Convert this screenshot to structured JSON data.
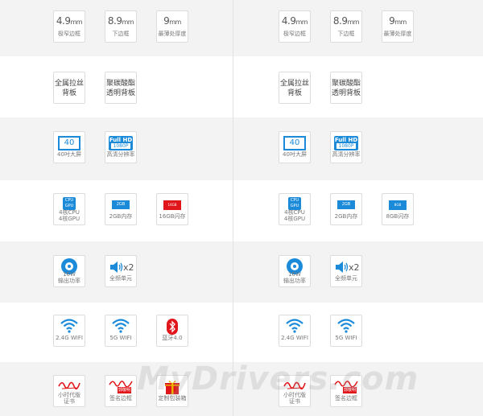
{
  "left": {
    "row1": [
      {
        "main": "4.9",
        "unit": "mm",
        "sub": "极窄边框"
      },
      {
        "main": "8.9",
        "unit": "mm",
        "sub": "下边框"
      },
      {
        "main": "9",
        "unit": "mm",
        "sub": "最薄处厚度"
      }
    ],
    "row2": [
      {
        "line1": "全属拉丝",
        "line2": "背板"
      },
      {
        "line1": "聚碳酸酯",
        "line2": "透明背板"
      }
    ],
    "row3": [
      {
        "icon": "40",
        "sub": "40吋大屏"
      },
      {
        "icon1": "Full HD",
        "icon2": "1080P",
        "sub": "高清分辨率"
      }
    ],
    "row4": [
      {
        "icon1": "CPU",
        "icon2": "GPU",
        "sub1": "4核CPU",
        "sub2": "4核GPU"
      },
      {
        "icon": "2GB",
        "sub": "2GB内存"
      },
      {
        "icon": "16GB",
        "sub": "16GB闪存"
      }
    ],
    "row5": [
      {
        "sub1": "16W",
        "sub2": "输出功率"
      },
      {
        "mult": "x2",
        "sub": "全频单元"
      }
    ],
    "row6": [
      {
        "sub": "2.4G WIFI"
      },
      {
        "sub": "5G WIFI"
      },
      {
        "sub": "蓝牙4.0"
      }
    ],
    "row7": [
      {
        "sub1": "小时代版",
        "sub2": "证书"
      },
      {
        "badge": "郭敬明",
        "sub": "签名边框"
      },
      {
        "sub": "定制包装箱"
      }
    ]
  },
  "right": {
    "row1": [
      {
        "main": "4.9",
        "unit": "mm",
        "sub": "极窄边框"
      },
      {
        "main": "8.9",
        "unit": "mm",
        "sub": "下边框"
      },
      {
        "main": "9",
        "unit": "mm",
        "sub": "最薄处厚度"
      }
    ],
    "row2": [
      {
        "line1": "全属拉丝",
        "line2": "背板"
      },
      {
        "line1": "聚碳酸酯",
        "line2": "透明背板"
      }
    ],
    "row3": [
      {
        "icon": "40",
        "sub": "40吋大屏"
      },
      {
        "icon1": "Full HD",
        "icon2": "1080P",
        "sub": "高清分辨率"
      }
    ],
    "row4": [
      {
        "icon1": "CPU",
        "icon2": "GPU",
        "sub1": "4核CPU",
        "sub2": "4核GPU"
      },
      {
        "icon": "2GB",
        "sub": "2GB内存"
      },
      {
        "icon": "8GB",
        "sub": "8GB闪存"
      }
    ],
    "row5": [
      {
        "sub1": "16W",
        "sub2": "输出功率"
      },
      {
        "mult": "x2",
        "sub": "全频单元"
      }
    ],
    "row6": [
      {
        "sub": "2.4G WIFI"
      },
      {
        "sub": "5G WIFI"
      }
    ],
    "row7": [
      {
        "sub1": "小时代版",
        "sub2": "证书"
      },
      {
        "badge": "郭敬明",
        "sub": "签名边框"
      }
    ]
  },
  "watermark": "MyDrivers.com",
  "colors": {
    "blue": "#1a8ad9",
    "red": "#e0161b",
    "gold": "#e8b400",
    "band": "#f3f3f3"
  }
}
